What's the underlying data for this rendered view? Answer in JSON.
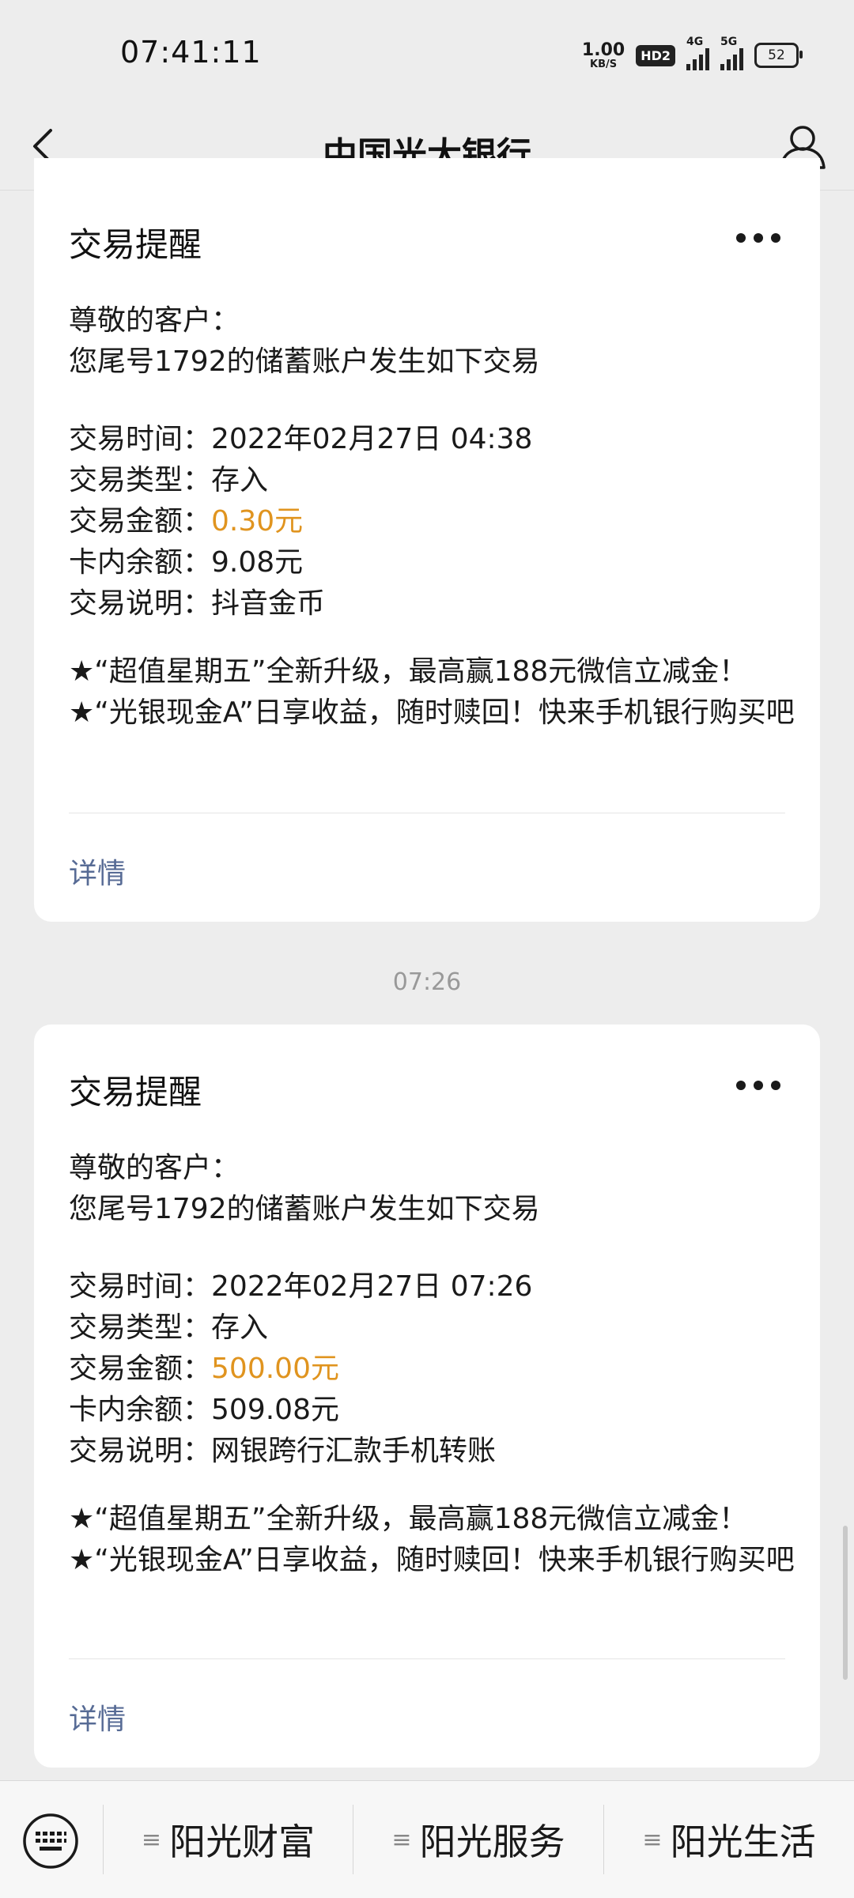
{
  "status_bar": {
    "time": "07:41:11",
    "net_speed": "1.00",
    "net_unit": "KB/S",
    "hd_badge": "HD2",
    "sig1_label": "4G",
    "sig2_label": "5G",
    "battery": "52"
  },
  "header": {
    "title": "中国光大银行",
    "back_icon": "chevron-left-icon",
    "profile_icon": "person-icon"
  },
  "colors": {
    "amount": "#e0941f",
    "link": "#576b95",
    "background": "#ededed"
  },
  "messages": [
    {
      "title": "交易提醒",
      "greeting": "尊敬的客户：",
      "intro": "您尾号1792的储蓄账户发生如下交易",
      "time_label": "交易时间：",
      "time_value": "2022年02月27日  04:38",
      "type_label": "交易类型：",
      "type_value": "存入",
      "amount_label": "交易金额：",
      "amount_value": "0.30元",
      "balance_label": "卡内余额：",
      "balance_value": "9.08元",
      "desc_label": "交易说明：",
      "desc_value": "抖音金币",
      "promo1": "★“超值星期五”全新升级，最高赢188元微信立减金！",
      "promo2": "★“光银现金A”日享收益，随时赎回！快来手机银行购买吧",
      "detail": "详情"
    },
    {
      "title": "交易提醒",
      "greeting": "尊敬的客户：",
      "intro": "您尾号1792的储蓄账户发生如下交易",
      "time_label": "交易时间：",
      "time_value": "2022年02月27日  07:26",
      "type_label": "交易类型：",
      "type_value": "存入",
      "amount_label": "交易金额：",
      "amount_value": "500.00元",
      "balance_label": "卡内余额：",
      "balance_value": "509.08元",
      "desc_label": "交易说明：",
      "desc_value": "网银跨行汇款手机转账",
      "promo1": "★“超值星期五”全新升级，最高赢188元微信立减金！",
      "promo2": "★“光银现金A”日享收益，随时赎回！快来手机银行购买吧",
      "detail": "详情"
    }
  ],
  "timestamp": "07:26",
  "bottom_menu": {
    "keyboard_icon": "keyboard-icon",
    "items": [
      "阳光财富",
      "阳光服务",
      "阳光生活"
    ]
  }
}
